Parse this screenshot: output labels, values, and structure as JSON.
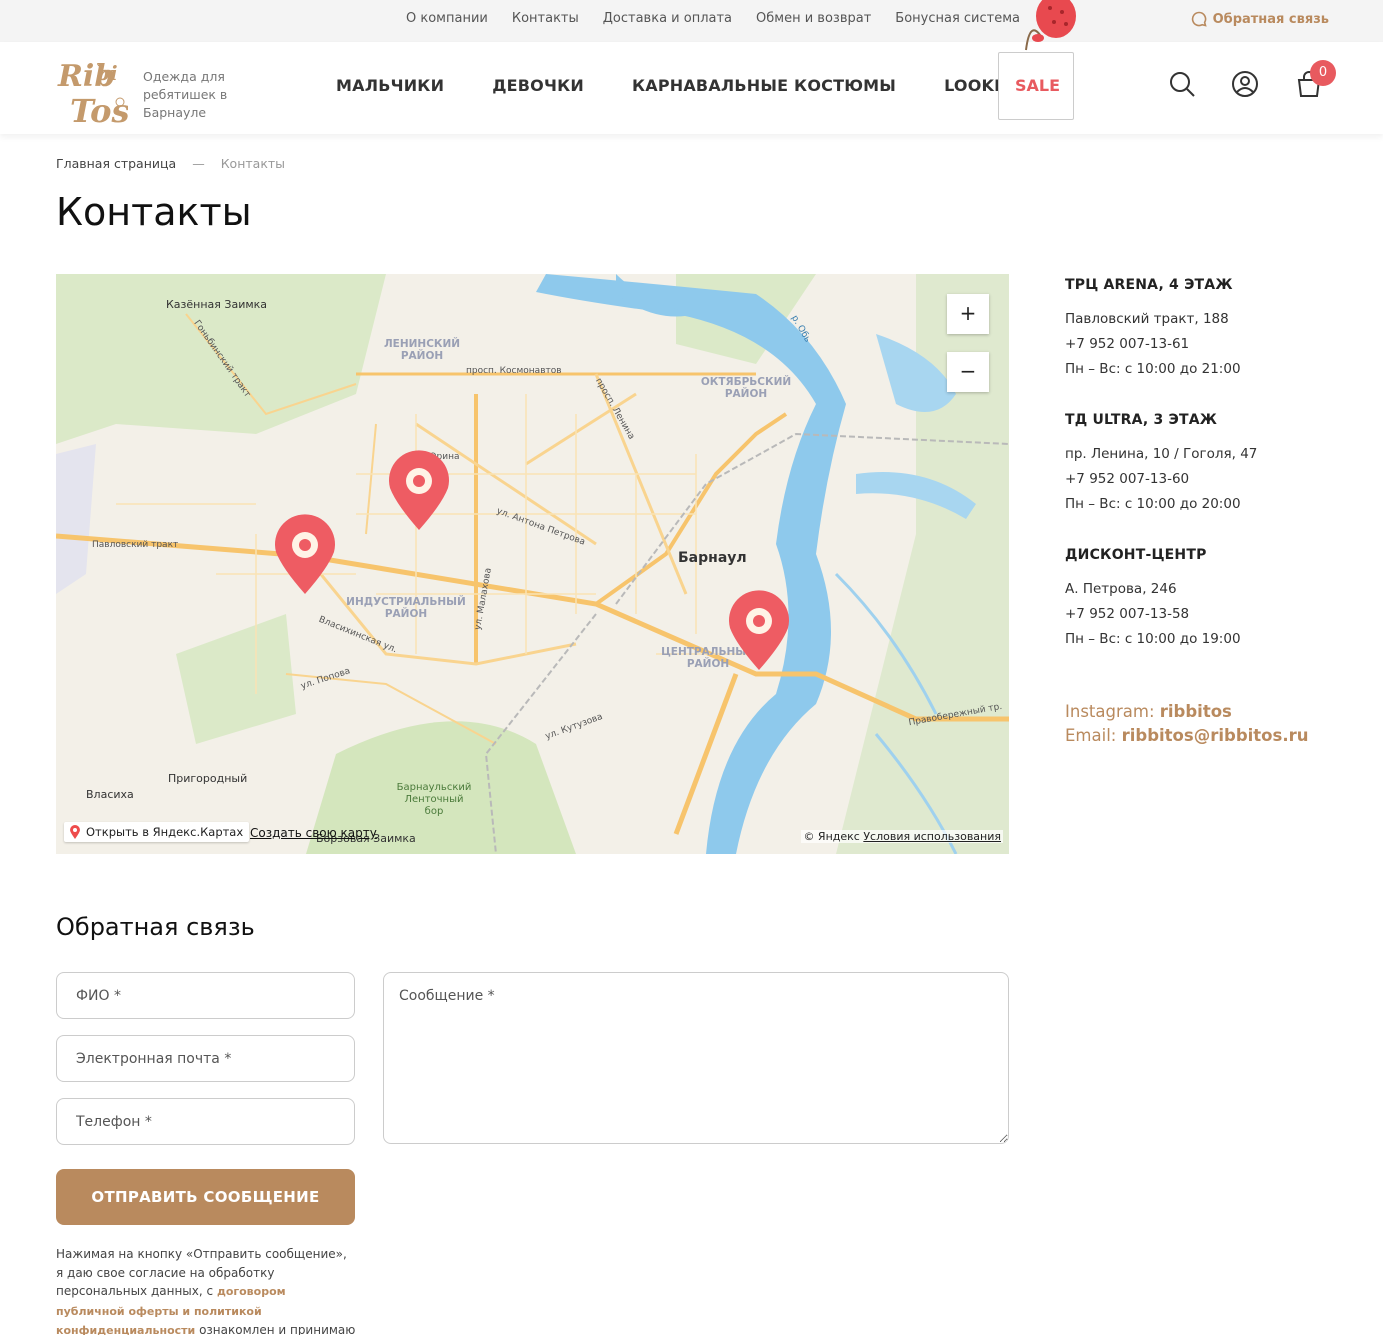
{
  "topbar": {
    "links": [
      "О компании",
      "Контакты",
      "Доставка и оплата",
      "Обмен и возврат",
      "Бонусная система"
    ],
    "feedback": "Обратная связь"
  },
  "header": {
    "tagline": "Одежда для ребятишек в Барнауле",
    "nav": [
      "МАЛЬЧИКИ",
      "ДЕВОЧКИ",
      "КАРНАВАЛЬНЫЕ КОСТЮМЫ",
      "LOOKBOOK"
    ],
    "sale": "SALE",
    "cart_count": "0",
    "logo_text": "Ribbi Tos"
  },
  "breadcrumb": {
    "home": "Главная страница",
    "separator": "—",
    "current": "Контакты"
  },
  "page_title": "Контакты",
  "map": {
    "places": [
      "Казённая Заимка",
      "Барнаул",
      "Пригородный",
      "Власиха",
      "Барнаульский Ленточный бор",
      "Борзовая Заимка"
    ],
    "districts": [
      "ЛЕНИНСКИЙ РАЙОН",
      "ОКТЯБРЬСКИЙ РАЙОН",
      "ИНДУСТРИАЛЬНЫЙ РАЙОН",
      "ЦЕНТРАЛЬНЫЙ РАЙОН"
    ],
    "streets": [
      "Павловский тракт",
      "просп. Космонавтов",
      "ул. Попова",
      "ул. Малахова",
      "просп. Ленина",
      "Власихинская ул.",
      "ул. Антона Петрова",
      "ул. Юрина",
      "Правобережный тр.",
      "ул. Кутузова",
      "р. Обь",
      "Гоньбинский тракт"
    ],
    "zoom_in": "+",
    "zoom_out": "−",
    "open_yandex": "Открыть в Яндекс.Картах",
    "create_map": "Создать свою карту",
    "copyright": "© Яндекс",
    "terms": "Условия использования"
  },
  "stores": [
    {
      "name": "ТРЦ ARENA, 4 ЭТАЖ",
      "address": "Павловский тракт, 188",
      "phone": "+7 952 007-13-61",
      "hours": "Пн – Вс: с 10:00 до 21:00"
    },
    {
      "name": "ТД ULTRA, 3 ЭТАЖ",
      "address": "пр. Ленина, 10 / Гоголя, 47",
      "phone": "+7 952 007-13-60",
      "hours": "Пн – Вс: с 10:00 до 20:00"
    },
    {
      "name": "ДИСКОНТ-ЦЕНТР",
      "address": "А. Петрова, 246",
      "phone": "+7 952 007-13-58",
      "hours": "Пн – Вс: с 10:00 до 19:00"
    }
  ],
  "social": {
    "instagram_label": "Instagram:",
    "instagram_value": "ribbitos",
    "email_label": "Email:",
    "email_value": "ribbitos@ribbitos.ru"
  },
  "form": {
    "title": "Обратная связь",
    "name_placeholder": "ФИО *",
    "email_placeholder": "Электронная почта *",
    "phone_placeholder": "Телефон *",
    "message_placeholder": "Сообщение *",
    "submit": "ОТПРАВИТЬ СООБЩЕНИЕ",
    "consent_text": "Нажимая на кнопку «Отправить сообщение», я даю свое согласие на обработку персональных данных, с",
    "consent_link": "договором публичной оферты и политикой конфиденциальности",
    "consent_tail": "ознакомлен и принимаю"
  },
  "colors": {
    "accent": "#b98a5e",
    "sale": "#e85a5f",
    "marker": "#ee5c63"
  }
}
